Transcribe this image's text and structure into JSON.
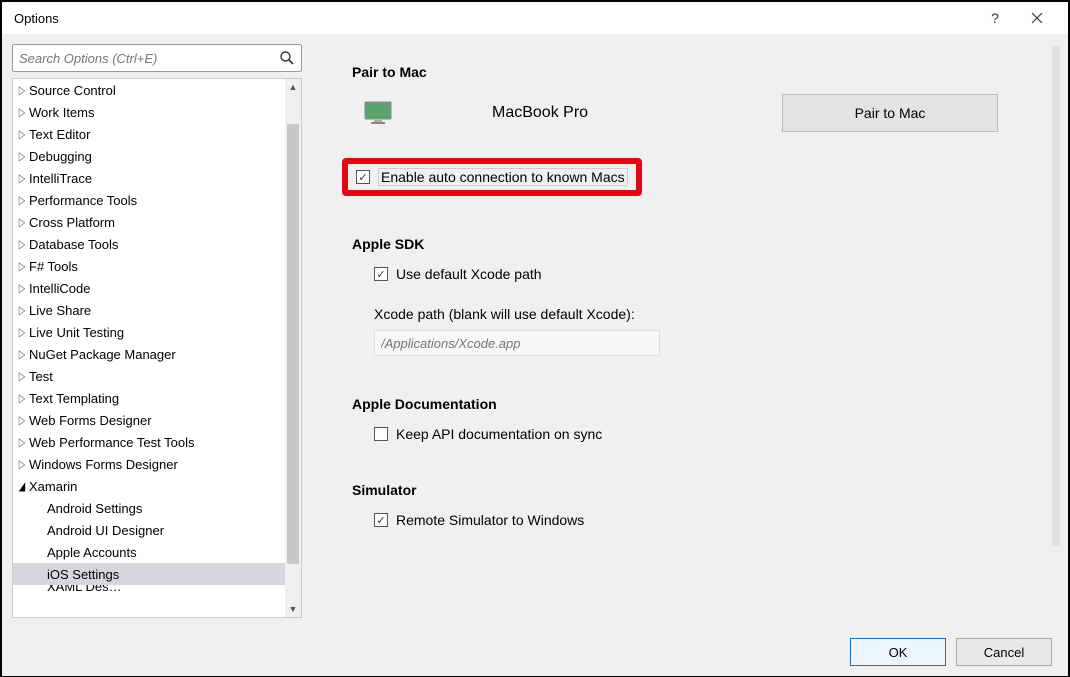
{
  "window": {
    "title": "Options"
  },
  "search": {
    "placeholder": "Search Options (Ctrl+E)"
  },
  "tree": {
    "items": [
      {
        "label": "Source Control",
        "expandable": true
      },
      {
        "label": "Work Items",
        "expandable": true
      },
      {
        "label": "Text Editor",
        "expandable": true
      },
      {
        "label": "Debugging",
        "expandable": true
      },
      {
        "label": "IntelliTrace",
        "expandable": true
      },
      {
        "label": "Performance Tools",
        "expandable": true
      },
      {
        "label": "Cross Platform",
        "expandable": true
      },
      {
        "label": "Database Tools",
        "expandable": true
      },
      {
        "label": "F# Tools",
        "expandable": true
      },
      {
        "label": "IntelliCode",
        "expandable": true
      },
      {
        "label": "Live Share",
        "expandable": true
      },
      {
        "label": "Live Unit Testing",
        "expandable": true
      },
      {
        "label": "NuGet Package Manager",
        "expandable": true
      },
      {
        "label": "Test",
        "expandable": true
      },
      {
        "label": "Text Templating",
        "expandable": true
      },
      {
        "label": "Web Forms Designer",
        "expandable": true
      },
      {
        "label": "Web Performance Test Tools",
        "expandable": true
      },
      {
        "label": "Windows Forms Designer",
        "expandable": true
      },
      {
        "label": "Xamarin",
        "expandable": true,
        "expanded": true,
        "children": [
          {
            "label": "Android Settings"
          },
          {
            "label": "Android UI Designer"
          },
          {
            "label": "Apple Accounts"
          },
          {
            "label": "iOS Settings",
            "selected": true
          },
          {
            "label": "XAML Designer",
            "cutoff": true
          }
        ]
      }
    ]
  },
  "content": {
    "pair": {
      "title": "Pair to Mac",
      "device": "MacBook Pro",
      "button": "Pair to Mac",
      "autoconnect_label": "Enable auto connection to known Macs",
      "autoconnect_checked": true
    },
    "sdk": {
      "title": "Apple SDK",
      "use_default_label": "Use default Xcode path",
      "use_default_checked": true,
      "path_label": "Xcode path (blank will use default Xcode):",
      "path_placeholder": "/Applications/Xcode.app"
    },
    "docs": {
      "title": "Apple Documentation",
      "sync_label": "Keep API documentation on sync",
      "sync_checked": false
    },
    "simulator": {
      "title": "Simulator",
      "remote_label": "Remote Simulator to Windows",
      "remote_checked": true
    }
  },
  "footer": {
    "ok": "OK",
    "cancel": "Cancel"
  }
}
